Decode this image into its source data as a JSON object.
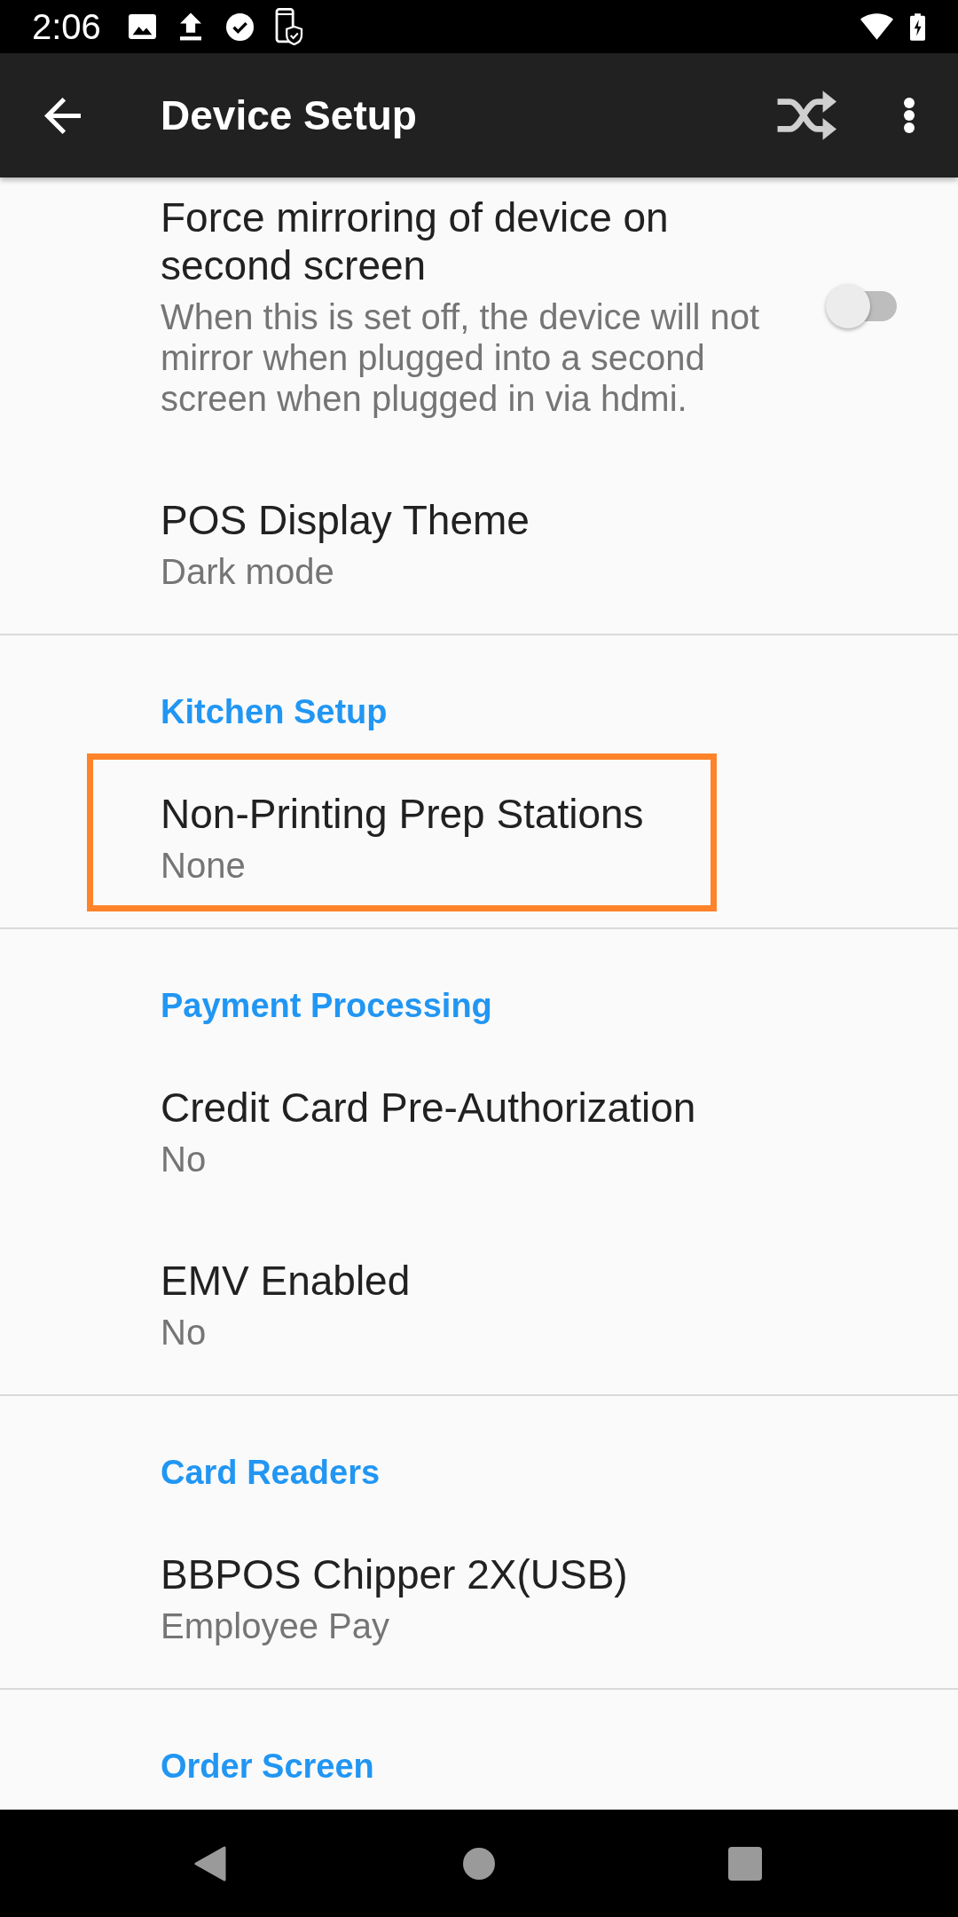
{
  "status_bar": {
    "time": "2:06"
  },
  "app_bar": {
    "title": "Device Setup"
  },
  "sections": [
    {
      "items": [
        {
          "kind": "switch",
          "title": "Force mirroring of device on second screen",
          "summary": "When this is set off, the device will not mirror when plugged into a second screen when plugged in via hdmi.",
          "on": false,
          "highlighted": false
        },
        {
          "kind": "text",
          "title": "POS Display Theme",
          "summary": "Dark mode",
          "highlighted": false
        }
      ]
    },
    {
      "header": "Kitchen Setup",
      "items": [
        {
          "kind": "text",
          "title": "Non-Printing Prep Stations",
          "summary": "None",
          "highlighted": true
        }
      ]
    },
    {
      "header": "Payment Processing",
      "items": [
        {
          "kind": "text",
          "title": "Credit Card Pre-Authorization",
          "summary": "No",
          "highlighted": false
        },
        {
          "kind": "text",
          "title": "EMV Enabled",
          "summary": "No",
          "highlighted": false
        }
      ]
    },
    {
      "header": "Card Readers",
      "items": [
        {
          "kind": "text",
          "title": "BBPOS Chipper 2X(USB)",
          "summary": "Employee Pay",
          "highlighted": false
        }
      ]
    },
    {
      "header": "Order Screen"
    }
  ]
}
